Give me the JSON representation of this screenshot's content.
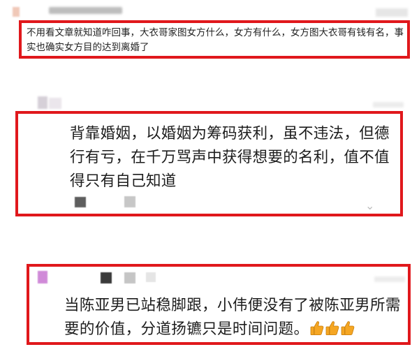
{
  "comments": [
    {
      "text": "不用看文章就知道咋回事，大衣哥家图女方什么，女方有什么，女方图大衣哥有钱有名，事实也确实女方目的达到离婚了"
    },
    {
      "text": "背靠婚姻，以婚姻为筹码获利，虽不违法，但德行有亏，在千万骂声中获得想要的名利，值不值得只有自己知道"
    },
    {
      "text": "当陈亚男已站稳脚跟，小伟便没有了被陈亚男所需要的价值，分道扬镳只是时间问题。",
      "emoji": [
        "thumbs-up",
        "thumbs-up",
        "thumbs-up"
      ]
    }
  ],
  "colors": {
    "highlight": "#e0181c",
    "emoji": "#f5a623"
  }
}
